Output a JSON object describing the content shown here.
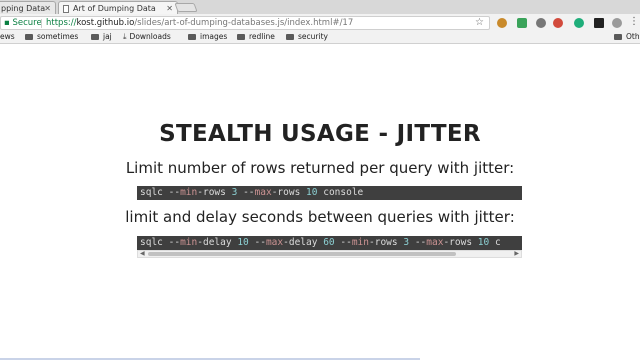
{
  "browser": {
    "tabs": [
      {
        "title": "pping Data"
      },
      {
        "title": "Art of Dumping Data"
      }
    ],
    "secure_label": "Secure",
    "url": {
      "scheme": "https://",
      "host": "kost.github.io",
      "path": "/slides/art-of-dumping-databases.js/index.html#/17"
    },
    "bookmarks": [
      "ews",
      "sometimes",
      "jaj",
      "Downloads",
      "images",
      "redline",
      "security",
      "Oth"
    ]
  },
  "slide": {
    "title": "STEALTH USAGE - JITTER",
    "caption1": "Limit number of rows returned per query with jitter:",
    "caption2": "limit and delay seconds between queries with jitter:",
    "code1": {
      "cmd": "sqlc",
      "p1": "--",
      "k1": "min",
      "r1": "-rows",
      "n1": "3",
      "p2": "--",
      "k2": "max",
      "r2": "-rows",
      "n2": "10",
      "tail": "console"
    },
    "code2": {
      "cmd": "sqlc",
      "p1": "--",
      "k1": "min",
      "r1": "-delay",
      "n1": "10",
      "p2": "--",
      "k2": "max",
      "r2": "-delay",
      "n2": "60",
      "p3": "--",
      "k3": "min",
      "r3": "-rows",
      "n3": "3",
      "p4": "--",
      "k4": "max",
      "r4": "-rows",
      "n4": "10",
      "tail": "c"
    }
  },
  "colors": {
    "keyword": "#cc9393",
    "number": "#8cd0d3",
    "code_bg": "#3f3f3f"
  }
}
